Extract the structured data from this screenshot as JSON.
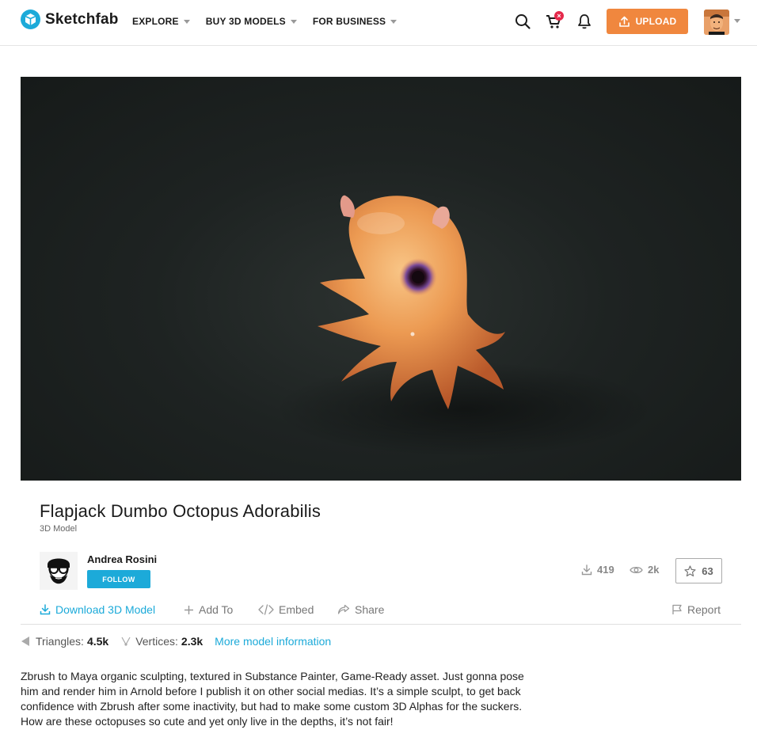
{
  "header": {
    "brand": "Sketchfab",
    "nav": [
      {
        "label": "EXPLORE"
      },
      {
        "label": "BUY 3D MODELS"
      },
      {
        "label": "FOR BUSINESS"
      }
    ],
    "upload_label": "UPLOAD",
    "cart_badge": "×",
    "accent_color": "#1caad9",
    "upload_color": "#f0873e"
  },
  "model": {
    "title": "Flapjack Dumbo Octopus Adorabilis",
    "type_label": "3D Model"
  },
  "author": {
    "name": "Andrea Rosini",
    "follow_label": "FOLLOW"
  },
  "stats": {
    "downloads": "419",
    "views": "2k",
    "likes": "63"
  },
  "actions": {
    "download": "Download 3D Model",
    "add_to": "Add To",
    "embed": "Embed",
    "share": "Share",
    "report": "Report"
  },
  "info": {
    "triangles_label": "Triangles:",
    "triangles_value": "4.5k",
    "vertices_label": "Vertices:",
    "vertices_value": "2.3k",
    "more_link": "More model information"
  },
  "description": "Zbrush to Maya organic sculpting, textured in Substance Painter, Game-Ready asset. Just gonna pose him and render him in Arnold before I publish it on other social medias. It’s a simple sculpt, to get back confidence with Zbrush after some inactivity, but had to make some custom 3D Alphas for the suckers. How are these octopuses so cute and yet only live in the depths, it’s not fair!"
}
